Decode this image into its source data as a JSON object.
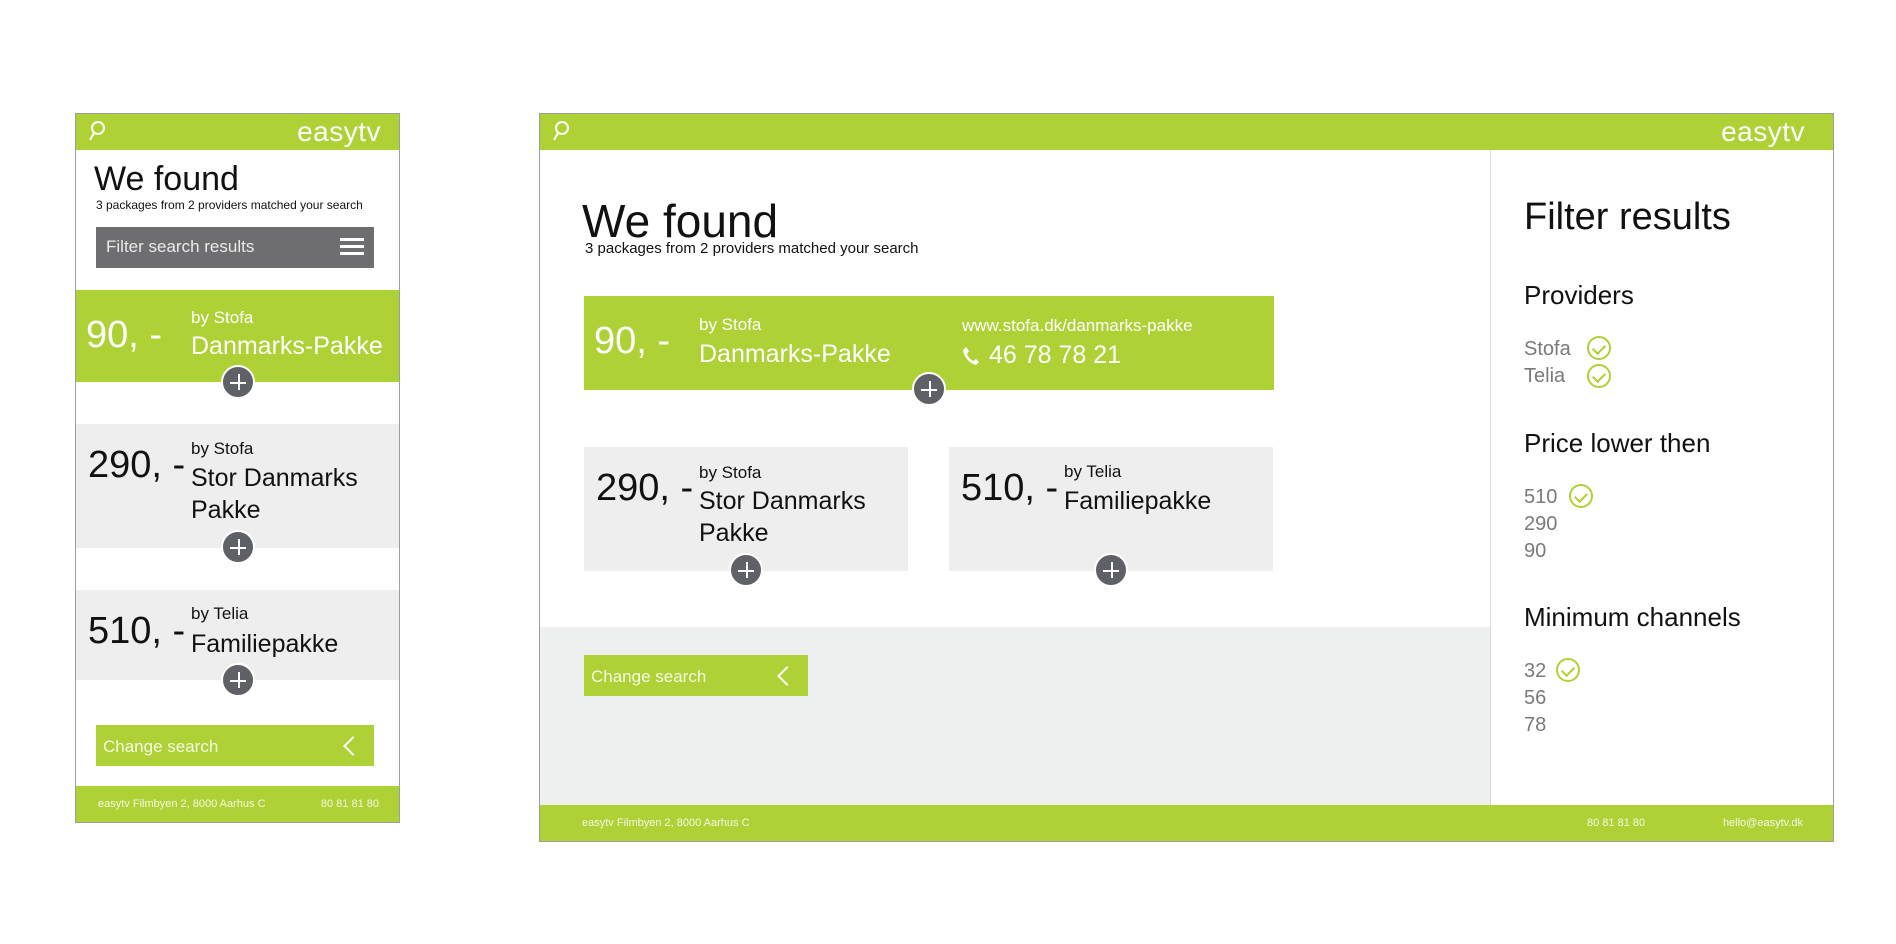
{
  "brand": "easytv",
  "header": {
    "search_icon": "search-icon"
  },
  "mobile": {
    "title": "We found",
    "subtitle": "3 packages from 2 providers matched your search",
    "filter_label": "Filter search results",
    "packages": [
      {
        "price": "90, -",
        "by": "by Stofa",
        "name": "Danmarks-Pakke"
      },
      {
        "price": "290, -",
        "by": "by Stofa",
        "name_line1": "Stor Danmarks",
        "name_line2": "Pakke"
      },
      {
        "price": "510, -",
        "by": "by Telia",
        "name": "Familiepakke"
      }
    ],
    "change_search": "Change search",
    "footer": {
      "address": "easytv  Filmbyen 2, 8000 Aarhus C",
      "phone": "80 81 81 80"
    }
  },
  "desktop": {
    "title": "We found",
    "subtitle": "3 packages from 2 providers matched your search",
    "featured": {
      "price": "90, -",
      "by": "by Stofa",
      "name": "Danmarks-Pakke",
      "url": "www.stofa.dk/danmarks-pakke",
      "phone": "46 78 78 21"
    },
    "packages": [
      {
        "price": "290, -",
        "by": "by Stofa",
        "name_line1": "Stor Danmarks",
        "name_line2": "Pakke"
      },
      {
        "price": "510, -",
        "by": "by Telia",
        "name": "Familiepakke"
      }
    ],
    "change_search": "Change search",
    "filter": {
      "title": "Filter results",
      "providers": {
        "heading": "Providers",
        "options": [
          {
            "label": "Stofa",
            "checked": true
          },
          {
            "label": "Telia",
            "checked": true
          }
        ]
      },
      "price": {
        "heading": "Price lower then",
        "options": [
          {
            "label": "510",
            "checked": true
          },
          {
            "label": "290",
            "checked": false
          },
          {
            "label": "90",
            "checked": false
          }
        ]
      },
      "channels": {
        "heading": "Minimum channels",
        "options": [
          {
            "label": "32",
            "checked": true
          },
          {
            "label": "56",
            "checked": false
          },
          {
            "label": "78",
            "checked": false
          }
        ]
      }
    },
    "footer": {
      "address": "easytv  Filmbyen 2, 8000 Aarhus C",
      "phone": "80 81 81 80",
      "email": "hello@easytv.dk"
    }
  },
  "colors": {
    "accent": "#aed136",
    "dark_grey": "#5f6167",
    "light_grey": "#eeeeee"
  }
}
